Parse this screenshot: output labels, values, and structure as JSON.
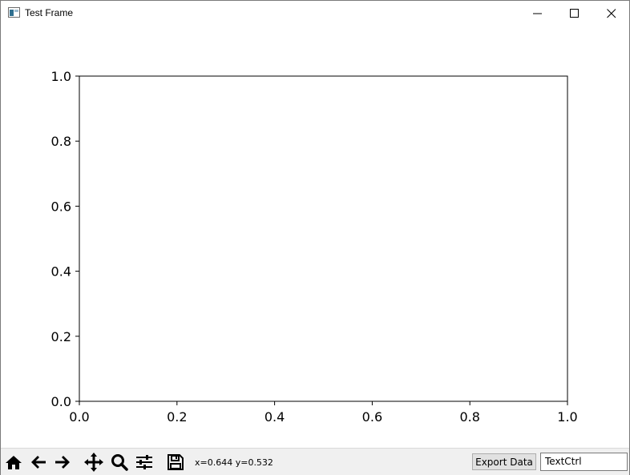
{
  "window": {
    "title": "Test Frame",
    "controls": [
      "minimize-icon",
      "maximize-icon",
      "close-icon"
    ]
  },
  "chart_data": {
    "type": "line",
    "series": [],
    "xlim": [
      0.0,
      1.0
    ],
    "ylim": [
      0.0,
      1.0
    ],
    "xticks": [
      "0.0",
      "0.2",
      "0.4",
      "0.6",
      "0.8",
      "1.0"
    ],
    "yticks": [
      "0.0",
      "0.2",
      "0.4",
      "0.6",
      "0.8",
      "1.0"
    ],
    "title": "",
    "xlabel": "",
    "ylabel": "",
    "grid": false
  },
  "toolbar": {
    "tools": [
      "home-icon",
      "back-icon",
      "forward-icon",
      "pan-icon",
      "zoom-icon",
      "configure-subplots-icon",
      "save-icon"
    ],
    "coordinates": "x=0.644 y=0.532",
    "export_label": "Export Data",
    "textctrl_value": "TextCtrl"
  }
}
